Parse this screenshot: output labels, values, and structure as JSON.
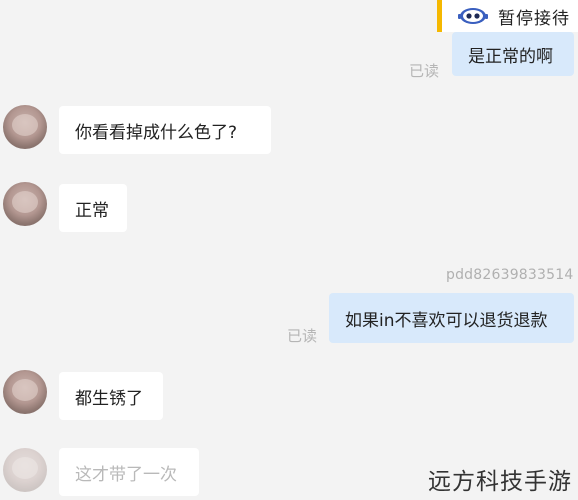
{
  "header": {
    "pause_label": "暂停接待",
    "pause_icon": "robot-icon",
    "accent_color": "#f5b800"
  },
  "messages": [
    {
      "side": "out",
      "text": "是正常的啊",
      "read": "已读"
    },
    {
      "side": "in",
      "text": "你看看掉成什么色了?"
    },
    {
      "side": "in",
      "text": "正常"
    },
    {
      "side": "out",
      "sender": "pdd82639833514",
      "text": "如果in不喜欢可以退货退款",
      "read": "已读"
    },
    {
      "side": "in",
      "text": "都生锈了"
    },
    {
      "side": "in",
      "text": "这才带了一次"
    }
  ],
  "watermark": "远方科技手游"
}
